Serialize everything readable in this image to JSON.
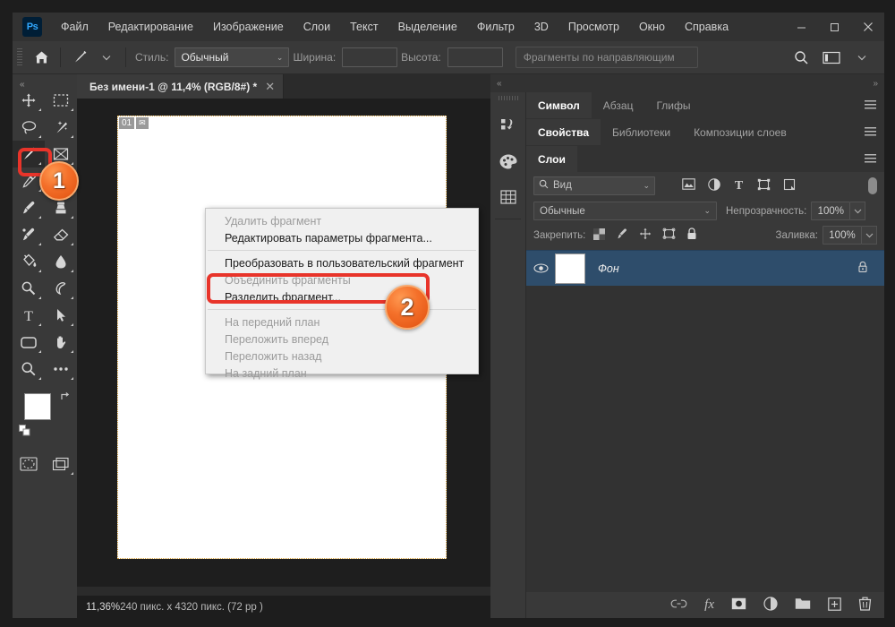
{
  "window": {
    "minimize_label": "—",
    "maximize_label": "❐",
    "close_label": "✕",
    "logo_label": "Ps"
  },
  "menubar": {
    "items": [
      {
        "label": "Файл"
      },
      {
        "label": "Редактирование"
      },
      {
        "label": "Изображение"
      },
      {
        "label": "Слои"
      },
      {
        "label": "Текст"
      },
      {
        "label": "Выделение"
      },
      {
        "label": "Фильтр"
      },
      {
        "label": "3D"
      },
      {
        "label": "Просмотр"
      },
      {
        "label": "Окно"
      },
      {
        "label": "Справка"
      }
    ]
  },
  "optionsbar": {
    "home_icon": "home-icon",
    "tool_icon": "slice-tool-icon",
    "style_label": "Стиль:",
    "style_value": "Обычный",
    "width_label": "Ширина:",
    "width_value": "",
    "height_label": "Высота:",
    "height_value": "",
    "slices_from_guides_label": "Фрагменты по направляющим",
    "search_icon": "search-icon",
    "workspace_icon": "workspace-icon",
    "chevron": "⌄"
  },
  "toolbar": {
    "collapse_label": "«",
    "tools": [
      {
        "name": "move-tool",
        "icon": "move"
      },
      {
        "name": "rectangular-marquee-tool",
        "icon": "marquee"
      },
      {
        "name": "lasso-tool",
        "icon": "lasso"
      },
      {
        "name": "magic-wand-tool",
        "icon": "wand"
      },
      {
        "name": "slice-tool",
        "icon": "slice",
        "active": true
      },
      {
        "name": "frame-tool",
        "icon": "frame"
      },
      {
        "name": "eyedropper-tool",
        "icon": "eyedropper"
      },
      {
        "name": "spot-healing-tool",
        "icon": "healing"
      },
      {
        "name": "brush-tool",
        "icon": "brush"
      },
      {
        "name": "clone-stamp-tool",
        "icon": "stamp"
      },
      {
        "name": "history-brush-tool",
        "icon": "historybrush"
      },
      {
        "name": "eraser-tool",
        "icon": "eraser"
      },
      {
        "name": "gradient-tool",
        "icon": "paintbucket"
      },
      {
        "name": "blur-tool",
        "icon": "blur"
      },
      {
        "name": "dodge-tool",
        "icon": "dodge"
      },
      {
        "name": "pen-tool",
        "icon": "pen"
      },
      {
        "name": "type-tool",
        "icon": "type"
      },
      {
        "name": "path-selection-tool",
        "icon": "pathselect"
      },
      {
        "name": "rectangle-tool",
        "icon": "rectangle"
      },
      {
        "name": "hand-tool",
        "icon": "hand"
      },
      {
        "name": "zoom-tool",
        "icon": "zoom"
      },
      {
        "name": "more-tools",
        "icon": "ellipsis"
      }
    ],
    "foreground_color": "#ffffff",
    "background_color": "#ffffff",
    "quickmask_name": "quick-mask-icon",
    "screenmode_name": "screen-mode-icon"
  },
  "document": {
    "tab_title": "Без имени-1 @ 11,4% (RGB/8#) *",
    "tab_close": "✕",
    "slice_number": "01",
    "slice_icon": "✉"
  },
  "statusbar": {
    "zoom": "11,36%",
    "dimensions": "240 пикс. x 4320 пикс. (72 pp )"
  },
  "contextmenu": {
    "items": [
      {
        "label": "Удалить фрагмент",
        "disabled": true
      },
      {
        "label": "Редактировать параметры фрагмента...",
        "disabled": false
      },
      {
        "separator": true
      },
      {
        "label": "Преобразовать в пользовательский фрагмент",
        "disabled": false
      },
      {
        "label": "Объединить фрагменты",
        "disabled": true
      },
      {
        "label": "Разделить фрагмент...",
        "disabled": false
      },
      {
        "separator": true
      },
      {
        "label": "На передний план",
        "disabled": true
      },
      {
        "label": "Переложить вперед",
        "disabled": true
      },
      {
        "label": "Переложить назад",
        "disabled": true
      },
      {
        "label": "На задний план",
        "disabled": true
      }
    ]
  },
  "rightdock": {
    "collapse_left": "«",
    "collapse_right": "»",
    "rail_icons": [
      {
        "name": "history-icon"
      },
      {
        "name": "swatches-icon"
      },
      {
        "name": "pattern-icon"
      }
    ],
    "group_character": {
      "tabs": [
        {
          "label": "Символ",
          "active": true
        },
        {
          "label": "Абзац",
          "active": false
        },
        {
          "label": "Глифы",
          "active": false
        }
      ]
    },
    "group_properties": {
      "tabs": [
        {
          "label": "Свойства",
          "active": true
        },
        {
          "label": "Библиотеки",
          "active": false
        },
        {
          "label": "Композиции слоев",
          "active": false
        }
      ]
    },
    "group_layers": {
      "tabs": [
        {
          "label": "Слои",
          "active": true
        }
      ],
      "filter_value": "Вид",
      "filter_icons": [
        {
          "name": "filter-image-icon"
        },
        {
          "name": "filter-adjustment-icon"
        },
        {
          "name": "filter-type-icon"
        },
        {
          "name": "filter-shape-icon"
        },
        {
          "name": "filter-smart-icon"
        }
      ],
      "blend_mode": "Обычные",
      "opacity_label": "Непрозрачность:",
      "opacity_value": "100%",
      "lock_label": "Закрепить:",
      "lock_icons": [
        {
          "name": "lock-transparency-icon"
        },
        {
          "name": "lock-image-icon"
        },
        {
          "name": "lock-position-icon"
        },
        {
          "name": "lock-artboard-icon"
        },
        {
          "name": "lock-all-icon"
        }
      ],
      "fill_label": "Заливка:",
      "fill_value": "100%",
      "layers": [
        {
          "name": "Фон",
          "locked": true,
          "visible": true
        }
      ],
      "footer_icons": [
        {
          "name": "link-layers-icon",
          "label": "⚭"
        },
        {
          "name": "layer-style-icon",
          "label": "fx"
        },
        {
          "name": "layer-mask-icon"
        },
        {
          "name": "adjustment-layer-icon"
        },
        {
          "name": "new-group-icon"
        },
        {
          "name": "new-layer-icon"
        },
        {
          "name": "delete-layer-icon"
        }
      ]
    }
  },
  "annotations": [
    {
      "name": "annotation-step-1",
      "badge": "1"
    },
    {
      "name": "annotation-step-2",
      "badge": "2"
    }
  ],
  "colors": {
    "accent_red": "#e8342a",
    "badge_orange": "#f4702a",
    "layer_selected": "#2e4d6b"
  }
}
